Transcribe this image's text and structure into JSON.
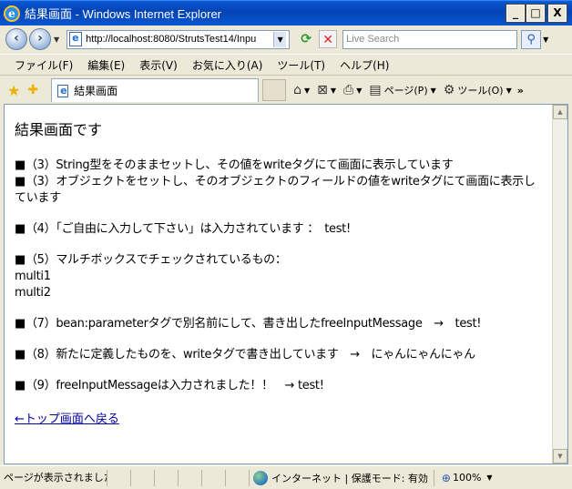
{
  "window": {
    "title": "結果画面 - Windows Internet Explorer",
    "minimize": "_",
    "maximize": "□",
    "close": "X"
  },
  "address": {
    "url": "http://localhost:8080/StrutsTest14/Inpu",
    "search_placeholder": "Live Search"
  },
  "menu": {
    "items": [
      "ファイル(F)",
      "編集(E)",
      "表示(V)",
      "お気に入り(A)",
      "ツール(T)",
      "ヘルプ(H)"
    ]
  },
  "tab": {
    "label": "結果画面"
  },
  "commands": {
    "page": "ページ(P)",
    "tools": "ツール(O)",
    "more": "»"
  },
  "content": {
    "heading": "結果画面です",
    "line3a": "■（3）String型をそのままセットし、その値をwriteタグにて画面に表示しています",
    "line3b": "■（3）オブジェクトをセットし、そのオブジェクトのフィールドの値をwriteタグにて画面に表示しています",
    "line4": "■（4）「ご自由に入力して下さい」は入力されています ：　test!",
    "line5": "■（5）マルチボックスでチェックされているもの：",
    "multi1": "multi1",
    "multi2": "multi2",
    "line7": "■（7）bean:parameterタグで別名前にして、書き出したfreeInputMessage　→　test!",
    "line8": "■（8）新たに定義したものを、writeタグで書き出しています　→　にゃんにゃんにゃん",
    "line9": "■（9）freeInputMessageは入力されました！！　→ test!",
    "back_link": "←トップ画面へ戻る"
  },
  "status": {
    "text": "ページが表示されました",
    "zone": "インターネット | 保護モード: 有効",
    "zoom": "100%"
  },
  "colors": {
    "titlebar": "#0343b5",
    "link": "#00009c"
  }
}
